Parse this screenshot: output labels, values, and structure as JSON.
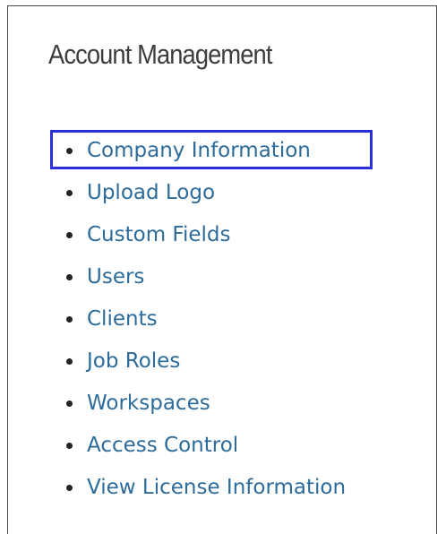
{
  "section_title": "Account Management",
  "menu": {
    "items": [
      {
        "label": "Company Information",
        "highlighted": true
      },
      {
        "label": "Upload Logo"
      },
      {
        "label": "Custom Fields"
      },
      {
        "label": "Users"
      },
      {
        "label": "Clients"
      },
      {
        "label": "Job Roles"
      },
      {
        "label": "Workspaces"
      },
      {
        "label": "Access Control"
      },
      {
        "label": "View License Information"
      }
    ]
  },
  "colors": {
    "link": "#2d6b9a",
    "highlight_border": "#2b2fd6",
    "title": "#3d3d3d"
  }
}
